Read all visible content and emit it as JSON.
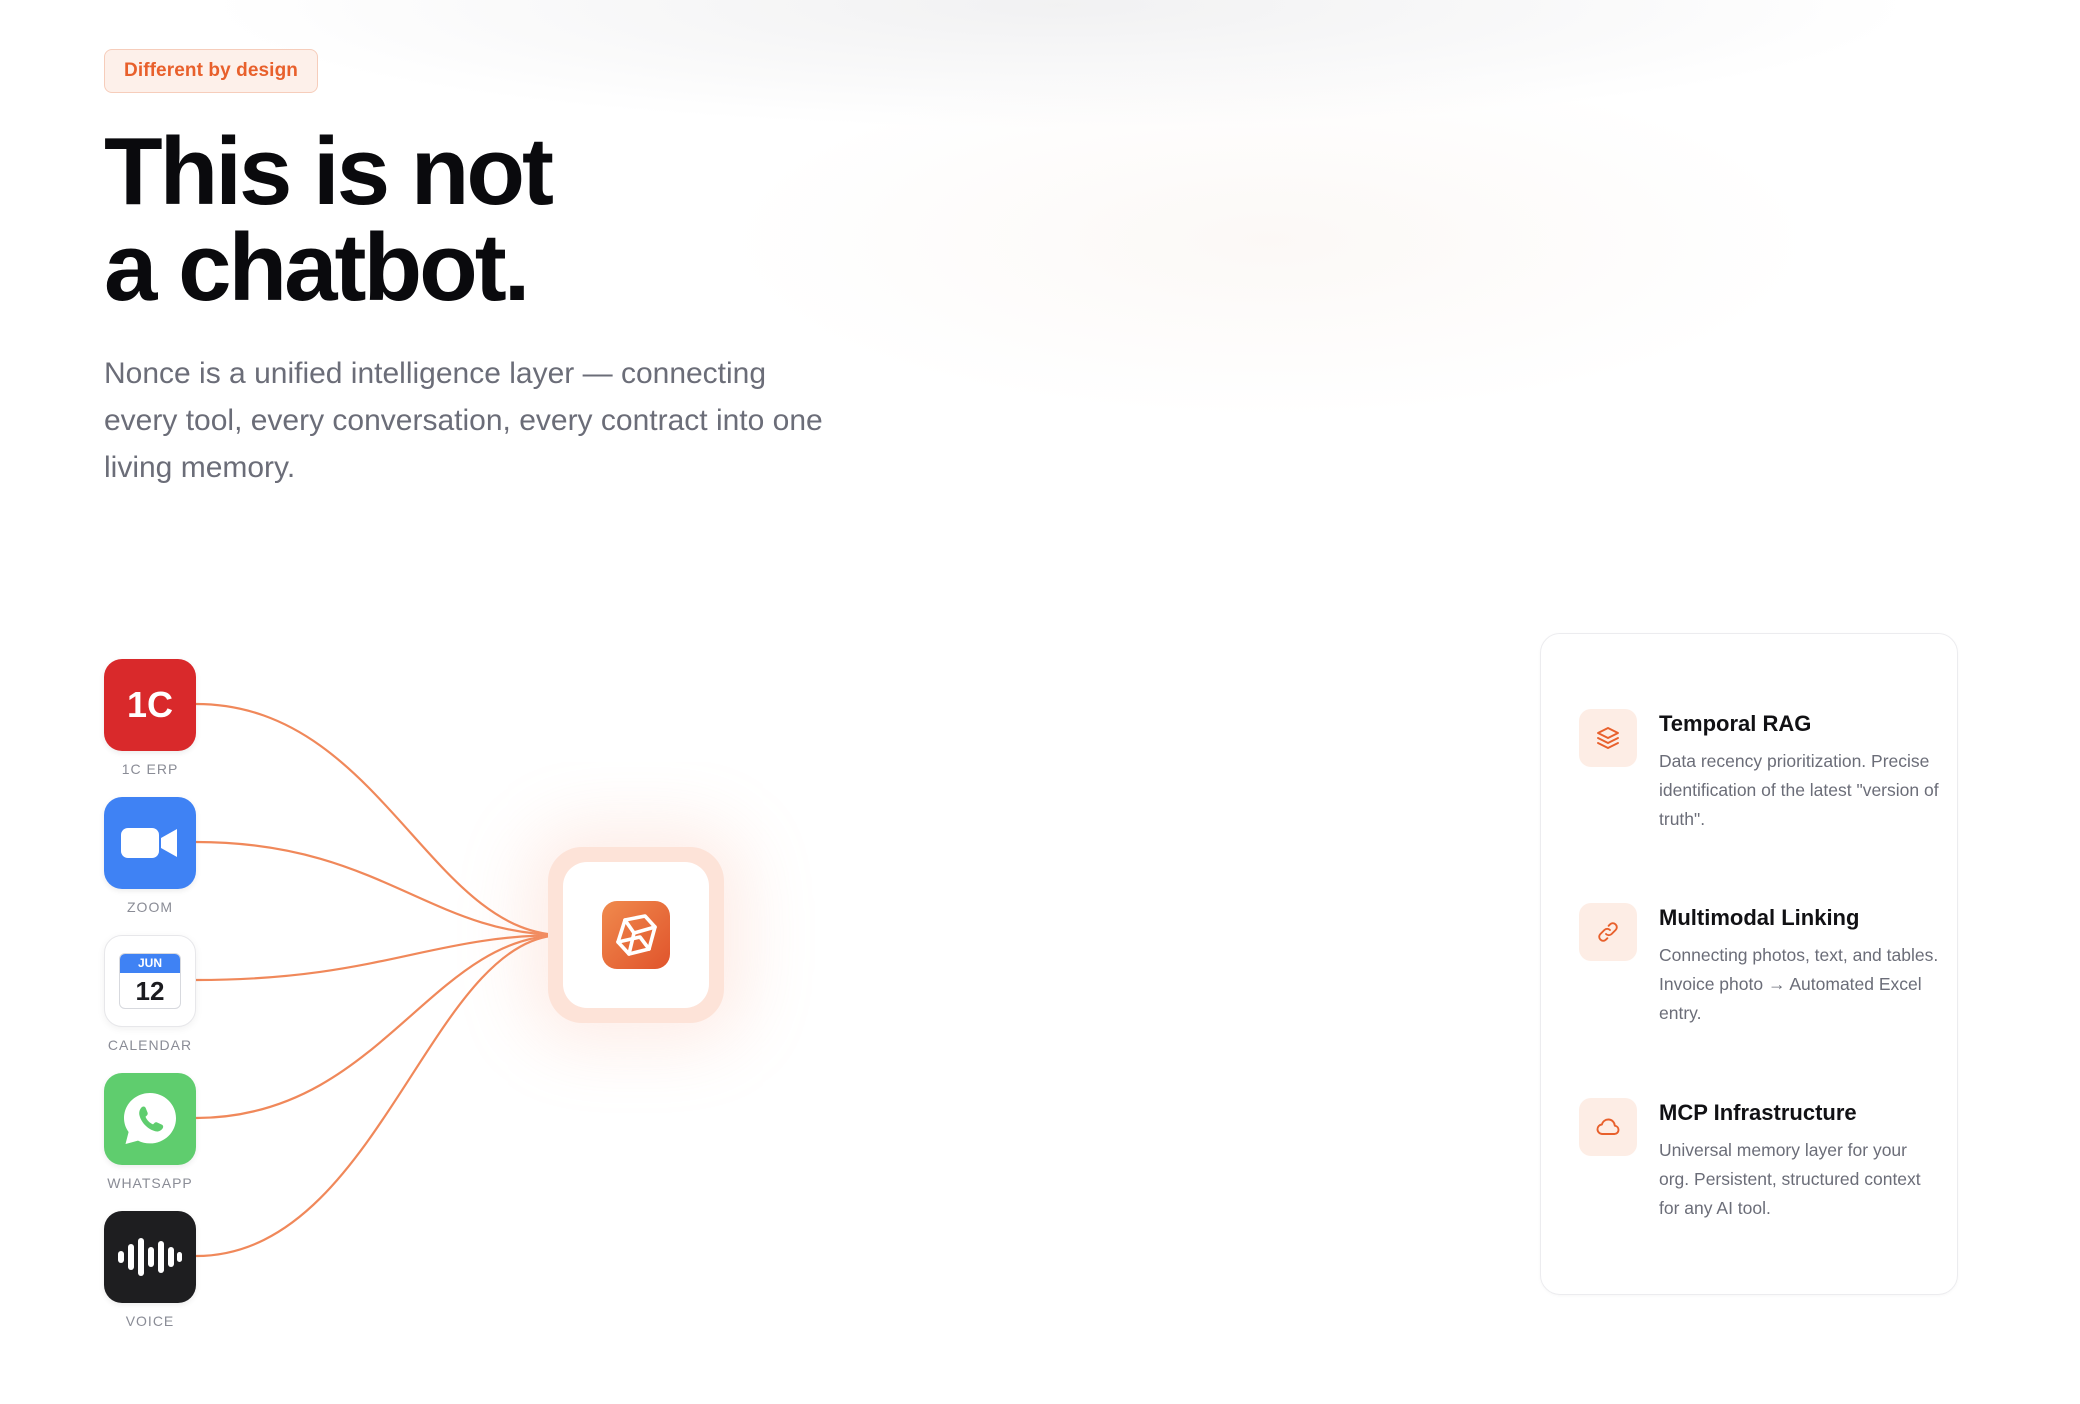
{
  "badge": {
    "label": "Different by design"
  },
  "hero": {
    "headline_line1": "This is not",
    "headline_line2": "a chatbot.",
    "lead": "Nonce is a unified intelligence layer — connecting every tool, every conversation, every contract into one living memory."
  },
  "sources": [
    {
      "label": "1C ERP",
      "icon": "1c-erp-icon",
      "glyph": "1C"
    },
    {
      "label": "ZOOM",
      "icon": "zoom-icon"
    },
    {
      "label": "CALENDAR",
      "icon": "calendar-icon",
      "month": "JUN",
      "day": "12"
    },
    {
      "label": "WHATSAPP",
      "icon": "whatsapp-icon"
    },
    {
      "label": "VOICE",
      "icon": "voice-waveform-icon"
    }
  ],
  "hub": {
    "icon": "nonce-logo-icon"
  },
  "features": [
    {
      "title": "Temporal RAG",
      "description": "Data recency prioritization. Precise identification of the latest \"version of truth\".",
      "icon": "layers-icon"
    },
    {
      "title": "Multimodal Linking",
      "description": "Connecting photos, text, and tables. Invoice photo → Automated Excel entry.",
      "icon": "link-icon"
    },
    {
      "title": "MCP Infrastructure",
      "description": "Universal memory layer for your org. Persistent, structured context for any AI tool.",
      "icon": "cloud-icon"
    }
  ],
  "colors": {
    "accent": "#e8602c",
    "wire": "#f0885a",
    "headline": "#0a0a0d",
    "muted_text": "#6b6d78"
  }
}
